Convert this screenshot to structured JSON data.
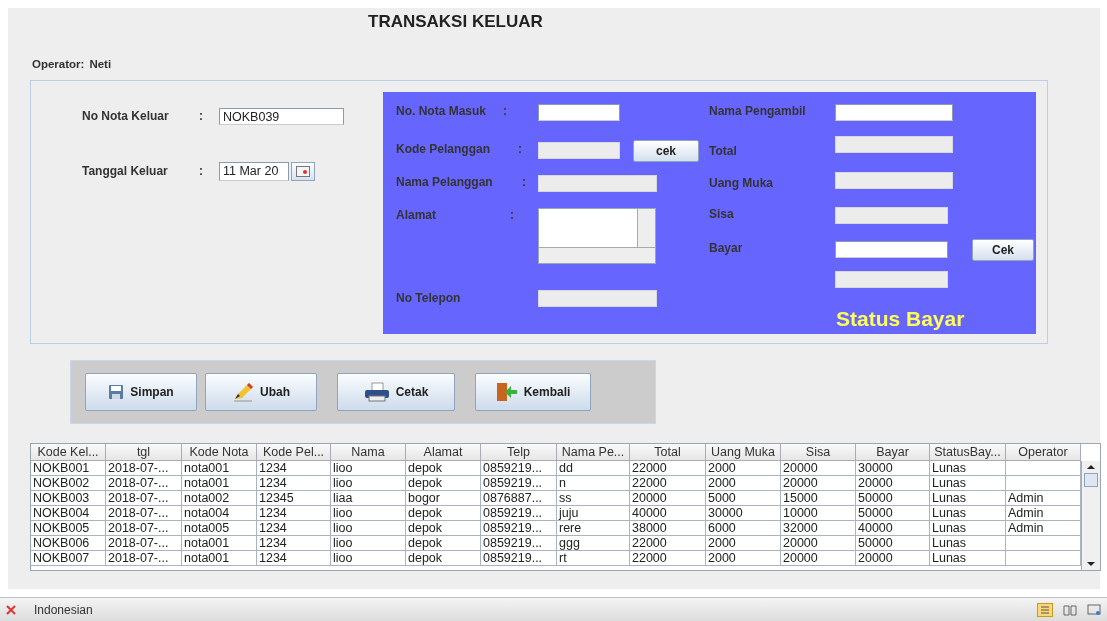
{
  "window": {
    "title": "TRANSAKSI KELUAR"
  },
  "operator": {
    "label": "Operator:",
    "value": "Neti"
  },
  "header_form": [
    {
      "label": "No Nota Keluar",
      "colon": ":",
      "kind": "text",
      "value": "NOKB039"
    },
    {
      "label": "Tanggal Keluar",
      "colon": ":",
      "kind": "date",
      "value": "11 Mar 20"
    }
  ],
  "detail_left": [
    {
      "label": "No. Nota Masuk",
      "colon": ":",
      "kind": "text",
      "disabled": false
    },
    {
      "label": "Kode Pelanggan",
      "colon": ":",
      "kind": "text",
      "disabled": true,
      "button": "cek"
    },
    {
      "label": "Nama Pelanggan",
      "colon": ":",
      "kind": "text",
      "disabled": true
    },
    {
      "label": "Alamat",
      "colon": ":",
      "kind": "textarea",
      "disabled": false
    },
    {
      "label": "No Telepon",
      "kind": "text",
      "disabled": true
    }
  ],
  "detail_right": [
    {
      "label": "Nama Pengambil",
      "kind": "text",
      "disabled": false
    },
    {
      "label": "Total",
      "kind": "text",
      "disabled": true
    },
    {
      "label": "Uang Muka",
      "kind": "text",
      "disabled": true
    },
    {
      "label": "Sisa",
      "kind": "text",
      "disabled": true
    },
    {
      "label": "Bayar",
      "kind": "text",
      "disabled": false,
      "button": "Cek"
    },
    {
      "kind": "text",
      "disabled": true
    }
  ],
  "status_label": "Status Bayar",
  "actions": [
    {
      "label": "Simpan",
      "kind": "save"
    },
    {
      "label": "Ubah",
      "kind": "edit"
    },
    {
      "label": "Cetak",
      "kind": "print"
    },
    {
      "label": "Kembali",
      "kind": "back"
    }
  ],
  "table": {
    "columns": [
      "Kode Kel...",
      "tgl",
      "Kode Nota",
      "Kode Pel...",
      "Nama",
      "Alamat",
      "Telp",
      "Nama Pe...",
      "Total",
      "Uang Muka",
      "Sisa",
      "Bayar",
      "StatusBay...",
      "Operator"
    ],
    "rows": [
      [
        "NOKB001",
        "2018-07-...",
        "nota001",
        "1234",
        "lioo",
        "depok",
        "0859219...",
        "dd",
        "22000",
        "2000",
        "20000",
        "30000",
        "Lunas"
      ],
      [
        "NOKB002",
        "2018-07-...",
        "nota001",
        "1234",
        "lioo",
        "depok",
        "0859219...",
        "n",
        "22000",
        "2000",
        "20000",
        "20000",
        "Lunas"
      ],
      [
        "NOKB003",
        "2018-07-...",
        "nota002",
        "12345",
        "liaa",
        "bogor",
        "0876887...",
        "ss",
        "20000",
        "5000",
        "15000",
        "50000",
        "Lunas",
        "Admin"
      ],
      [
        "NOKB004",
        "2018-07-...",
        "nota004",
        "1234",
        "lioo",
        "depok",
        "0859219...",
        "juju",
        "40000",
        "30000",
        "10000",
        "50000",
        "Lunas",
        "Admin"
      ],
      [
        "NOKB005",
        "2018-07-...",
        "nota005",
        "1234",
        "lioo",
        "depok",
        "0859219...",
        "rere",
        "38000",
        "6000",
        "32000",
        "40000",
        "Lunas",
        "Admin"
      ],
      [
        "NOKB006",
        "2018-07-...",
        "nota001",
        "1234",
        "lioo",
        "depok",
        "0859219...",
        "ggg",
        "22000",
        "2000",
        "20000",
        "50000",
        "Lunas"
      ],
      [
        "NOKB007",
        "2018-07-...",
        "nota001",
        "1234",
        "lioo",
        "depok",
        "0859219...",
        "rt",
        "22000",
        "2000",
        "20000",
        "20000",
        "Lunas"
      ]
    ]
  },
  "status_bar": {
    "language": "Indonesian"
  }
}
